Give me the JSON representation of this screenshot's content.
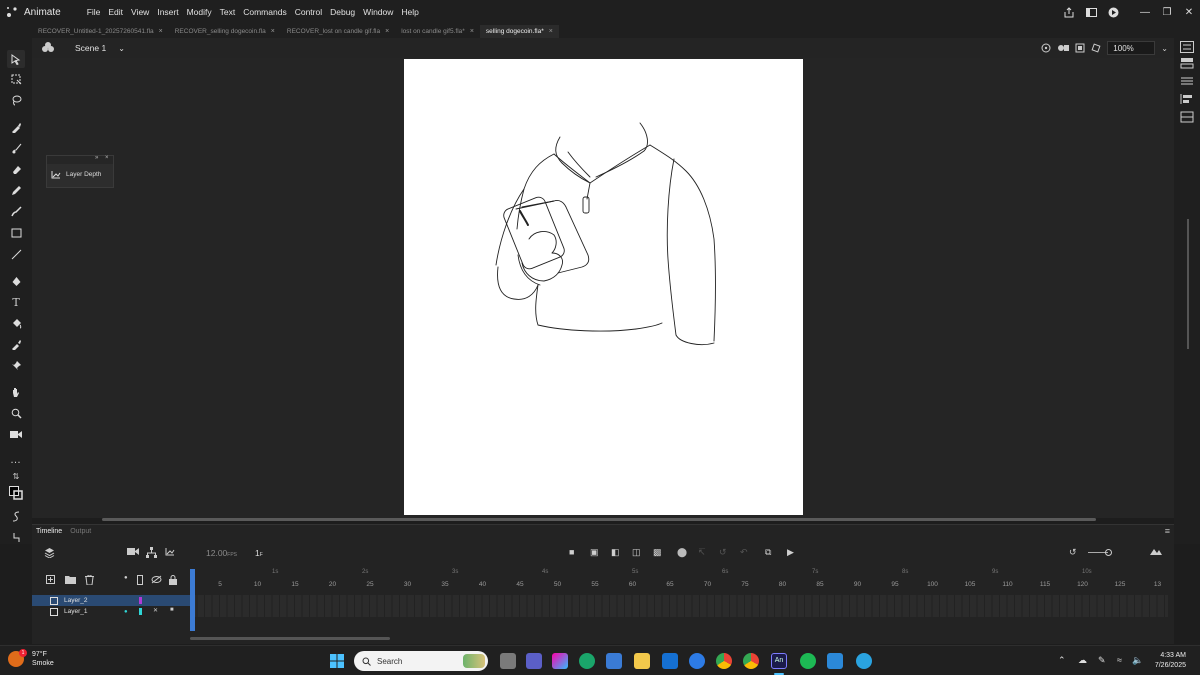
{
  "app": {
    "name": "Animate",
    "menu": [
      "File",
      "Edit",
      "View",
      "Insert",
      "Modify",
      "Text",
      "Commands",
      "Control",
      "Debug",
      "Window",
      "Help"
    ]
  },
  "tabs": [
    {
      "label": "RECOVER_Untitled-1_20257260541.fla",
      "active": false
    },
    {
      "label": "RECOVER_selling dogecoin.fla",
      "active": false
    },
    {
      "label": "RECOVER_lost on candle gif.fla",
      "active": false
    },
    {
      "label": "lost on candle gif5.fla*",
      "active": false
    },
    {
      "label": "selling dogecoin.fla*",
      "active": true
    }
  ],
  "scene": {
    "label": "Scene 1",
    "zoom": "100%"
  },
  "float_panel": {
    "button_label": "Layer Depth"
  },
  "timeline": {
    "tab_timeline": "Timeline",
    "tab_output": "Output",
    "fps": "12.00",
    "fps_unit": "FPS",
    "current_frame": "1",
    "ruler_numbers": [
      "5",
      "10",
      "15",
      "20",
      "25",
      "30",
      "35",
      "40",
      "45",
      "50",
      "55",
      "60",
      "65",
      "70",
      "75",
      "80",
      "85",
      "90",
      "95",
      "100",
      "105",
      "110",
      "115",
      "120",
      "125",
      "13"
    ],
    "second_markers": [
      "1s",
      "2s",
      "3s",
      "4s",
      "5s",
      "6s",
      "7s",
      "8s",
      "9s",
      "10s"
    ],
    "layers": [
      {
        "name": "Layer_2",
        "color": "#b13ad6",
        "selected": true
      },
      {
        "name": "Layer_1",
        "color": "#2fd6d6",
        "selected": false
      }
    ]
  },
  "taskbar": {
    "weather_temp": "97°F",
    "weather_desc": "Smoke",
    "weather_badge": "1",
    "search_placeholder": "Search",
    "time": "4:33 AM",
    "date": "7/26/2025"
  },
  "colors": {
    "accent": "#3c7bd4",
    "stage": "#ffffff",
    "pasteboard": "#252525"
  }
}
